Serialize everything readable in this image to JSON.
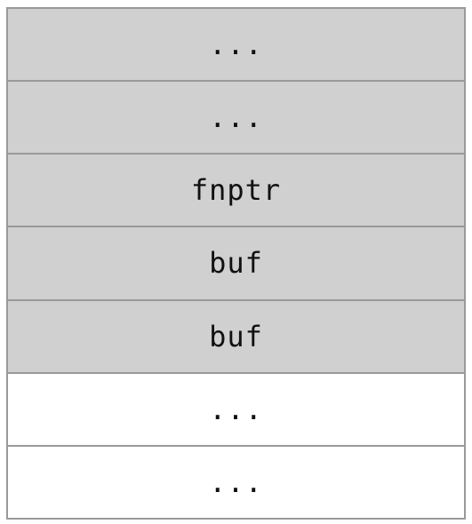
{
  "stack": {
    "cells": [
      {
        "label": "...",
        "shaded": true
      },
      {
        "label": "...",
        "shaded": true
      },
      {
        "label": "fnptr",
        "shaded": true
      },
      {
        "label": "buf",
        "shaded": true
      },
      {
        "label": "buf",
        "shaded": true
      },
      {
        "label": "...",
        "shaded": false
      },
      {
        "label": "...",
        "shaded": false
      }
    ]
  },
  "colors": {
    "shaded_fill": "#d0d0d0",
    "plain_fill": "#ffffff",
    "border": "#999999"
  }
}
